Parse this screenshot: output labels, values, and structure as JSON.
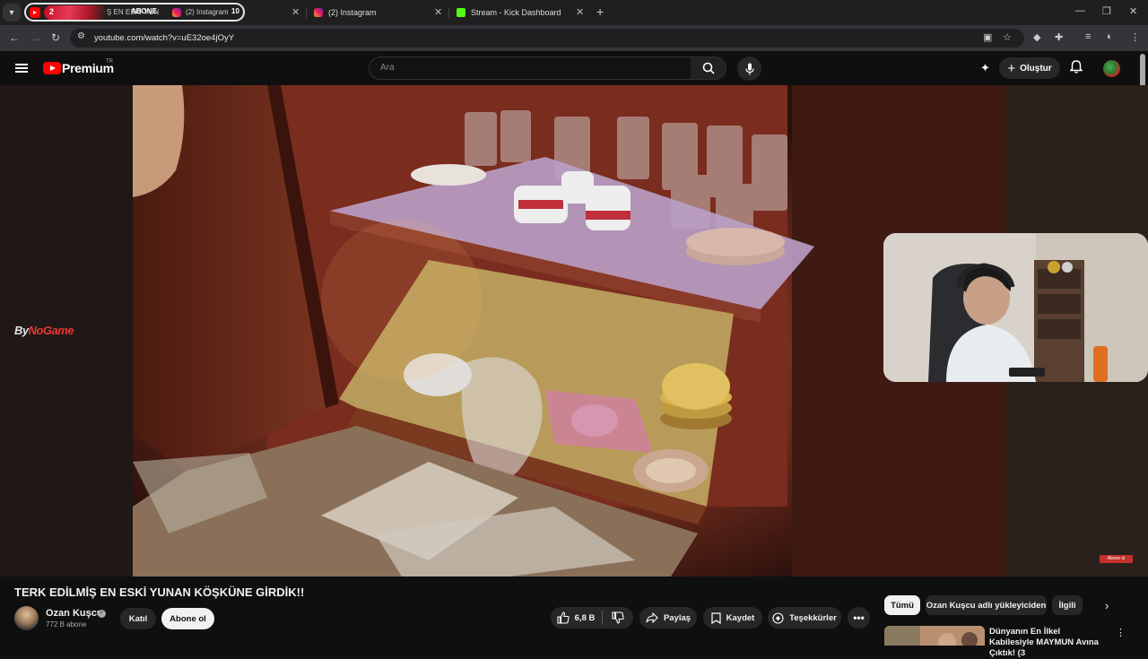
{
  "browser": {
    "tab_group": {
      "yt_count": "2",
      "yt_title_fragment": "Ş EN ESKİ YUN",
      "overlay_text": "ABONE",
      "ig_title": "(2) Instagram",
      "counter": "10"
    },
    "tabs": [
      {
        "title": "(2) Instagram",
        "icon": "instagram-icon"
      },
      {
        "title": "Stream - Kick Dashboard",
        "icon": "kick-icon"
      }
    ],
    "url": "youtube.com/watch?v=uE32oe4jOyY"
  },
  "header": {
    "logo": "Premium",
    "logo_region": "TR",
    "search_placeholder": "Ara",
    "create_label": "Oluştur"
  },
  "video": {
    "watermark_prefix": "By",
    "watermark_brand": "NoGame",
    "subscribe_badge": "Abone ol"
  },
  "details": {
    "title": "TERK EDİLMİŞ EN ESKİ YUNAN KÖŞKÜNE GİRDİK!!",
    "channel": "Ozan Kuşcu",
    "subscribers": "772 B abone",
    "join_label": "Katıl",
    "subscribe_label": "Abone ol",
    "likes": "6,8 B",
    "share_label": "Paylaş",
    "save_label": "Kaydet",
    "thanks_label": "Teşekkürler"
  },
  "recommendations": {
    "chips": [
      "Tümü",
      "Ozan Kuşcu adlı yükleyiciden",
      "İlgili"
    ],
    "first_title": "Dünyanın En İlkel Kabilesiyle MAYMUN Avına Çıktık! (3"
  },
  "colors": {
    "youtube_red": "#ff0000",
    "background": "#0f0f0f",
    "chip_bg": "#272727"
  }
}
